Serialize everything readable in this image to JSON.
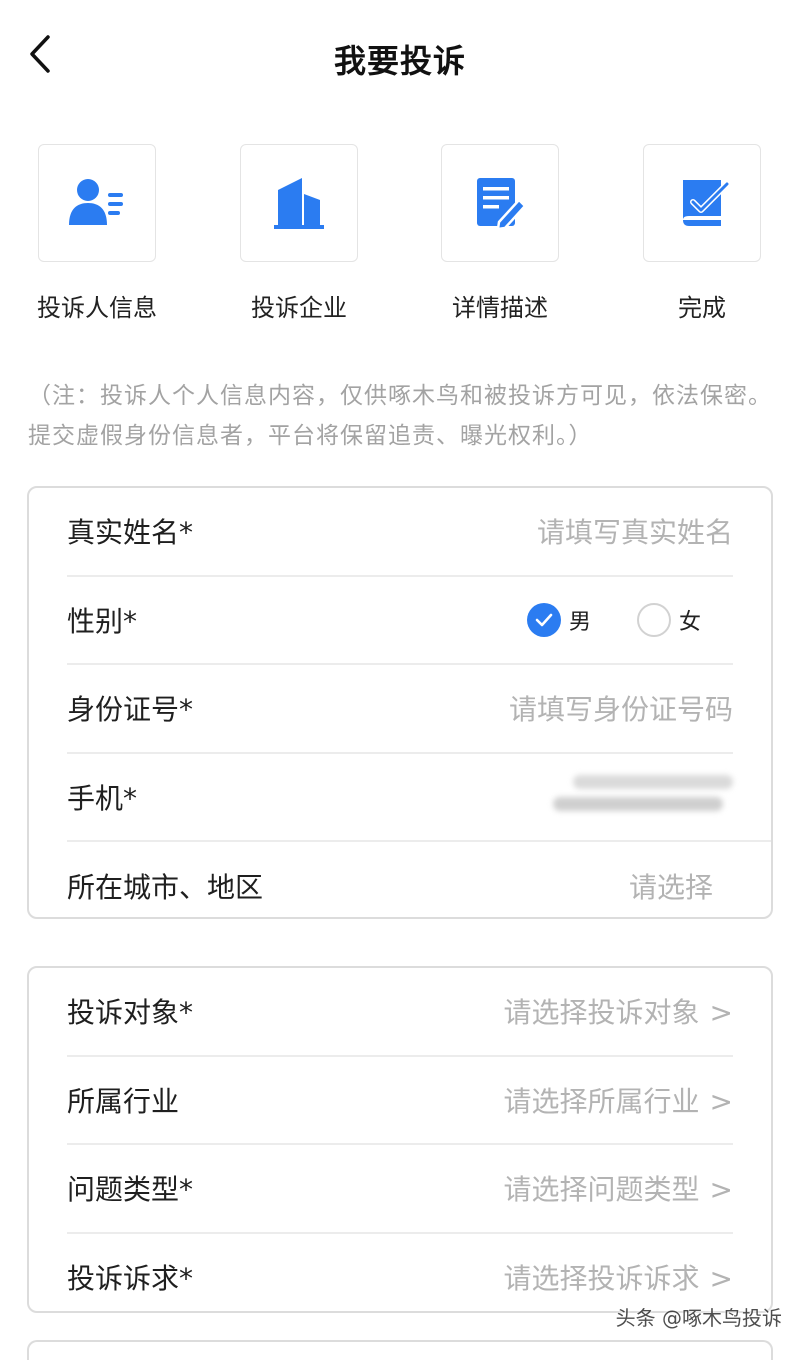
{
  "header": {
    "title": "我要投诉",
    "back_icon": "chevron-left-icon"
  },
  "steps": [
    {
      "label": "投诉人信息",
      "icon": "person-card-icon"
    },
    {
      "label": "投诉企业",
      "icon": "building-icon"
    },
    {
      "label": "详情描述",
      "icon": "document-edit-icon"
    },
    {
      "label": "完成",
      "icon": "check-book-icon"
    }
  ],
  "notice": "（注：投诉人个人信息内容，仅供啄木鸟和被投诉方可见，依法保密。提交虚假身份信息者，平台将保留追责、曝光权利。）",
  "personal": {
    "name": {
      "label": "真实姓名*",
      "placeholder": "请填写真实姓名"
    },
    "gender": {
      "label": "性别*",
      "options": [
        "男",
        "女"
      ],
      "selected": "男"
    },
    "id_number": {
      "label": "身份证号*",
      "placeholder": "请填写身份证号码"
    },
    "phone": {
      "label": "手机*"
    },
    "city": {
      "label": "所在城市、地区",
      "placeholder": "请选择"
    }
  },
  "complaint": {
    "target": {
      "label": "投诉对象*",
      "placeholder": "请选择投诉对象"
    },
    "industry": {
      "label": "所属行业",
      "placeholder": "请选择所属行业"
    },
    "issue_type": {
      "label": "问题类型*",
      "placeholder": "请选择问题类型"
    },
    "demand": {
      "label": "投诉诉求*",
      "placeholder": "请选择投诉诉求"
    }
  },
  "arrow": ">",
  "watermark": "头条 @啄木鸟投诉",
  "colors": {
    "accent": "#2b7cf1",
    "placeholder": "#b3b3b3",
    "border": "#dcdcdc"
  }
}
